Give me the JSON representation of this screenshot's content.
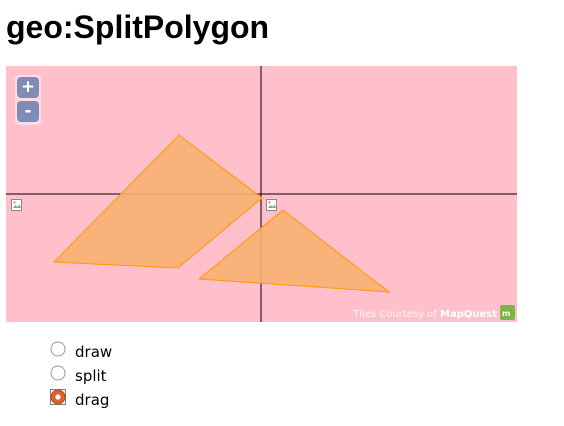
{
  "page": {
    "title": "geo:SplitPolygon"
  },
  "map": {
    "zoom_in_label": "+",
    "zoom_out_label": "-",
    "attribution_prefix": "Tiles Courtesy of ",
    "attribution_brand": "MapQuest",
    "background_color": "#ffc0cb",
    "polygon_fill": "#f7b071",
    "polygon_stroke": "#ff9900",
    "icons": [
      "broken-tile-image-icon",
      "mapquest-logo-icon"
    ]
  },
  "controls": {
    "selected": "drag",
    "options": [
      {
        "value": "draw",
        "label": "draw"
      },
      {
        "value": "split",
        "label": "split"
      },
      {
        "value": "drag",
        "label": "drag"
      }
    ],
    "selected_color": "#e06030"
  }
}
